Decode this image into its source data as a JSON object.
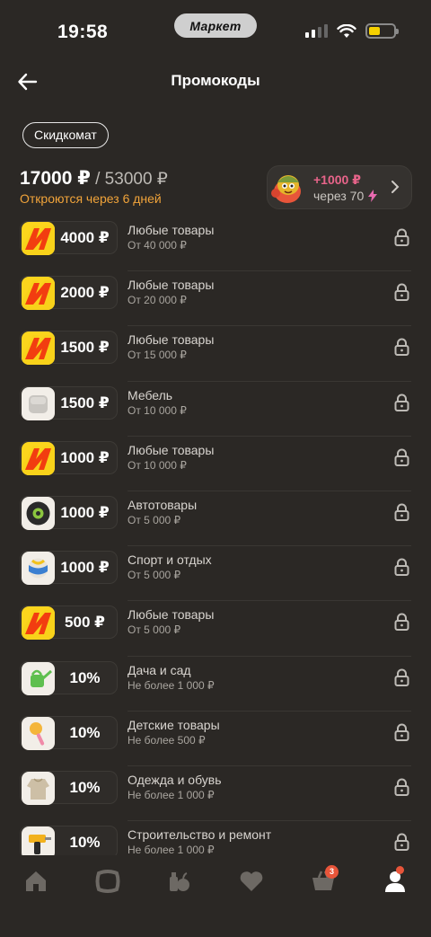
{
  "status_bar": {
    "time": "19:58",
    "pill": "Маркет"
  },
  "header": {
    "title": "Промокоды"
  },
  "chip": "Скидкомат",
  "summary": {
    "amount": "17000 ₽",
    "total": " / 53000 ₽",
    "opens": "Откроются через 6 дней"
  },
  "bonus": {
    "amount": "+1000 ₽",
    "sub": "через 70"
  },
  "promos": [
    {
      "value": "4000 ₽",
      "category": "Любые товары",
      "condition": "От 40 000 ₽",
      "thumb": "market-logo-icon"
    },
    {
      "value": "2000 ₽",
      "category": "Любые товары",
      "condition": "От 20 000 ₽",
      "thumb": "market-logo-icon"
    },
    {
      "value": "1500 ₽",
      "category": "Любые товары",
      "condition": "От 15 000 ₽",
      "thumb": "market-logo-icon"
    },
    {
      "value": "1500 ₽",
      "category": "Мебель",
      "condition": "От 10 000 ₽",
      "thumb": "furniture-icon"
    },
    {
      "value": "1000 ₽",
      "category": "Любые товары",
      "condition": "От 10 000 ₽",
      "thumb": "market-logo-icon"
    },
    {
      "value": "1000 ₽",
      "category": "Автотовары",
      "condition": "От 5 000 ₽",
      "thumb": "tire-icon"
    },
    {
      "value": "1000 ₽",
      "category": "Спорт и отдых",
      "condition": "От 5 000 ₽",
      "thumb": "ball-icon"
    },
    {
      "value": "500 ₽",
      "category": "Любые товары",
      "condition": "От 5 000 ₽",
      "thumb": "market-logo-icon"
    },
    {
      "value": "10%",
      "category": "Дача и сад",
      "condition": "Не более 1 000 ₽",
      "thumb": "watering-can-icon"
    },
    {
      "value": "10%",
      "category": "Детские товары",
      "condition": "Не более 500 ₽",
      "thumb": "rattle-icon"
    },
    {
      "value": "10%",
      "category": "Одежда и обувь",
      "condition": "Не более 1 000 ₽",
      "thumb": "clothes-icon"
    },
    {
      "value": "10%",
      "category": "Строительство и ремонт",
      "condition": "Не более 1 000 ₽",
      "thumb": "drill-icon"
    }
  ],
  "tabbar": {
    "cart_badge": "3"
  },
  "colors": {
    "accent_orange": "#f0a33a",
    "bonus_pink": "#e8648a",
    "badge_red": "#e8553a"
  }
}
